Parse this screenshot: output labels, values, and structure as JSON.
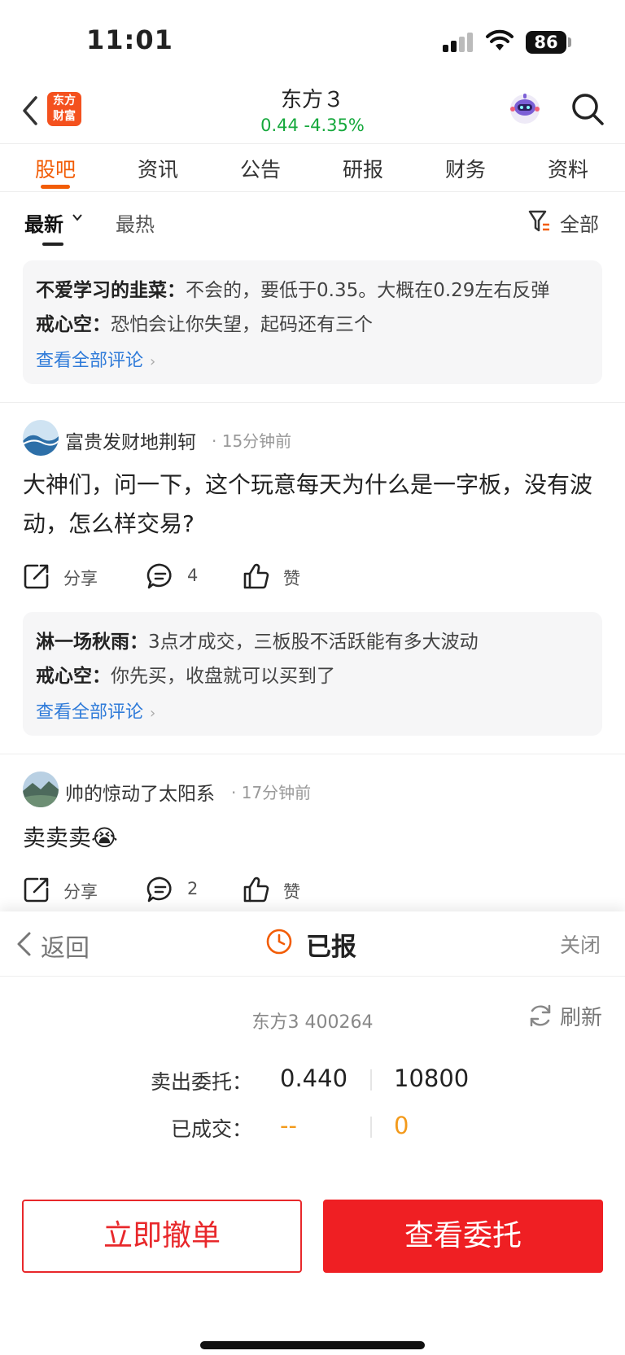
{
  "status_bar": {
    "time": "11:01",
    "battery": "86"
  },
  "header": {
    "logo_line1": "东方",
    "logo_line2": "财富",
    "stock_name": "东方３",
    "stock_quote": "0.44  -4.35%"
  },
  "tabs": [
    "股吧",
    "资讯",
    "公告",
    "研报",
    "财务",
    "资料"
  ],
  "filter": {
    "sort_new": "最新",
    "sort_hot": "最热",
    "filter_all": "全部"
  },
  "top_comments": {
    "c1_user": "不爱学习的韭菜：",
    "c1_text": "不会的，要低于0.35。大概在0.29左右反弹",
    "c2_user": "戒心空：",
    "c2_text": "恐怕会让你失望，起码还有三个",
    "view_all": "查看全部评论"
  },
  "posts": [
    {
      "author": "富贵发财地荆轲",
      "time": "· 15分钟前",
      "body": "大神们，问一下，这个玩意每天为什么是一字板，没有波动，怎么样交易?",
      "share": "分享",
      "comments": "4",
      "like": "赞",
      "reply1_user": "淋一场秋雨：",
      "reply1_text": "3点才成交，三板股不活跃能有多大波动",
      "reply2_user": "戒心空：",
      "reply2_text": "你先买，收盘就可以买到了",
      "view_all": "查看全部评论"
    },
    {
      "author": "帅的惊动了太阳系",
      "time": "· 17分钟前",
      "body": "卖卖卖😭",
      "share": "分享",
      "comments": "2",
      "like": "赞"
    }
  ],
  "order_panel": {
    "back": "返回",
    "status": "已报",
    "close": "关闭",
    "stock": "东方3 400264",
    "refresh": "刷新",
    "sell_label": "卖出委托：",
    "sell_price": "0.440",
    "sell_qty": "10800",
    "filled_label": "已成交：",
    "filled_price": "--",
    "filled_qty": "0",
    "cancel_button": "立即撤单",
    "view_button": "查看委托"
  },
  "colors": {
    "accent": "#f25c05",
    "up_down_green": "#15a83c",
    "link": "#2f7bd9",
    "button_red": "#ef1f23",
    "pending_orange": "#f39a1b"
  }
}
